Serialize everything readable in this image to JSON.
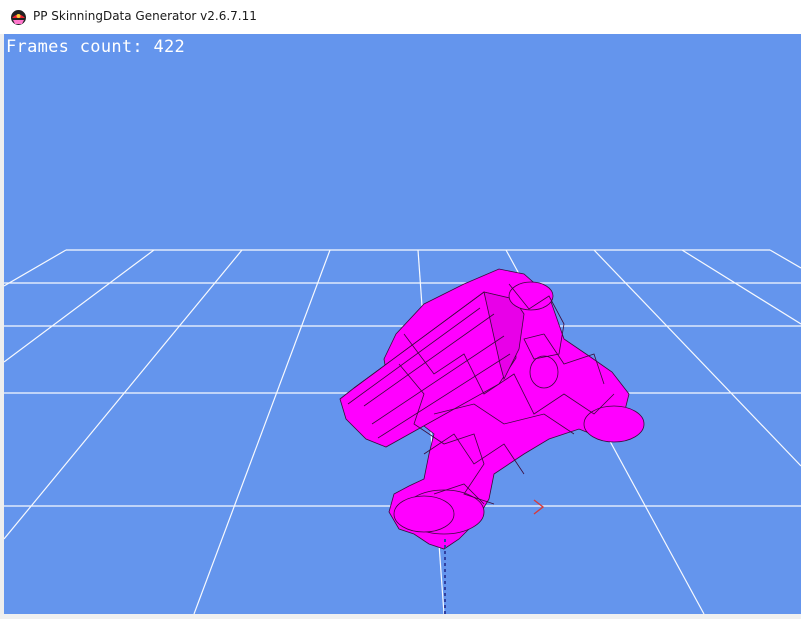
{
  "window": {
    "title": "PP SkinningData Generator v2.6.7.11",
    "icon": "app-icon"
  },
  "viewport": {
    "background": "#6495ed",
    "grid_color": "#ffffff",
    "model_color": "#ff00ff",
    "wire_color": "#3b0a3b",
    "axis_x_color": "#d83a3a",
    "axis_y_color": "#3040a0"
  },
  "overlay": {
    "frames_label": "Frames count: 422"
  }
}
